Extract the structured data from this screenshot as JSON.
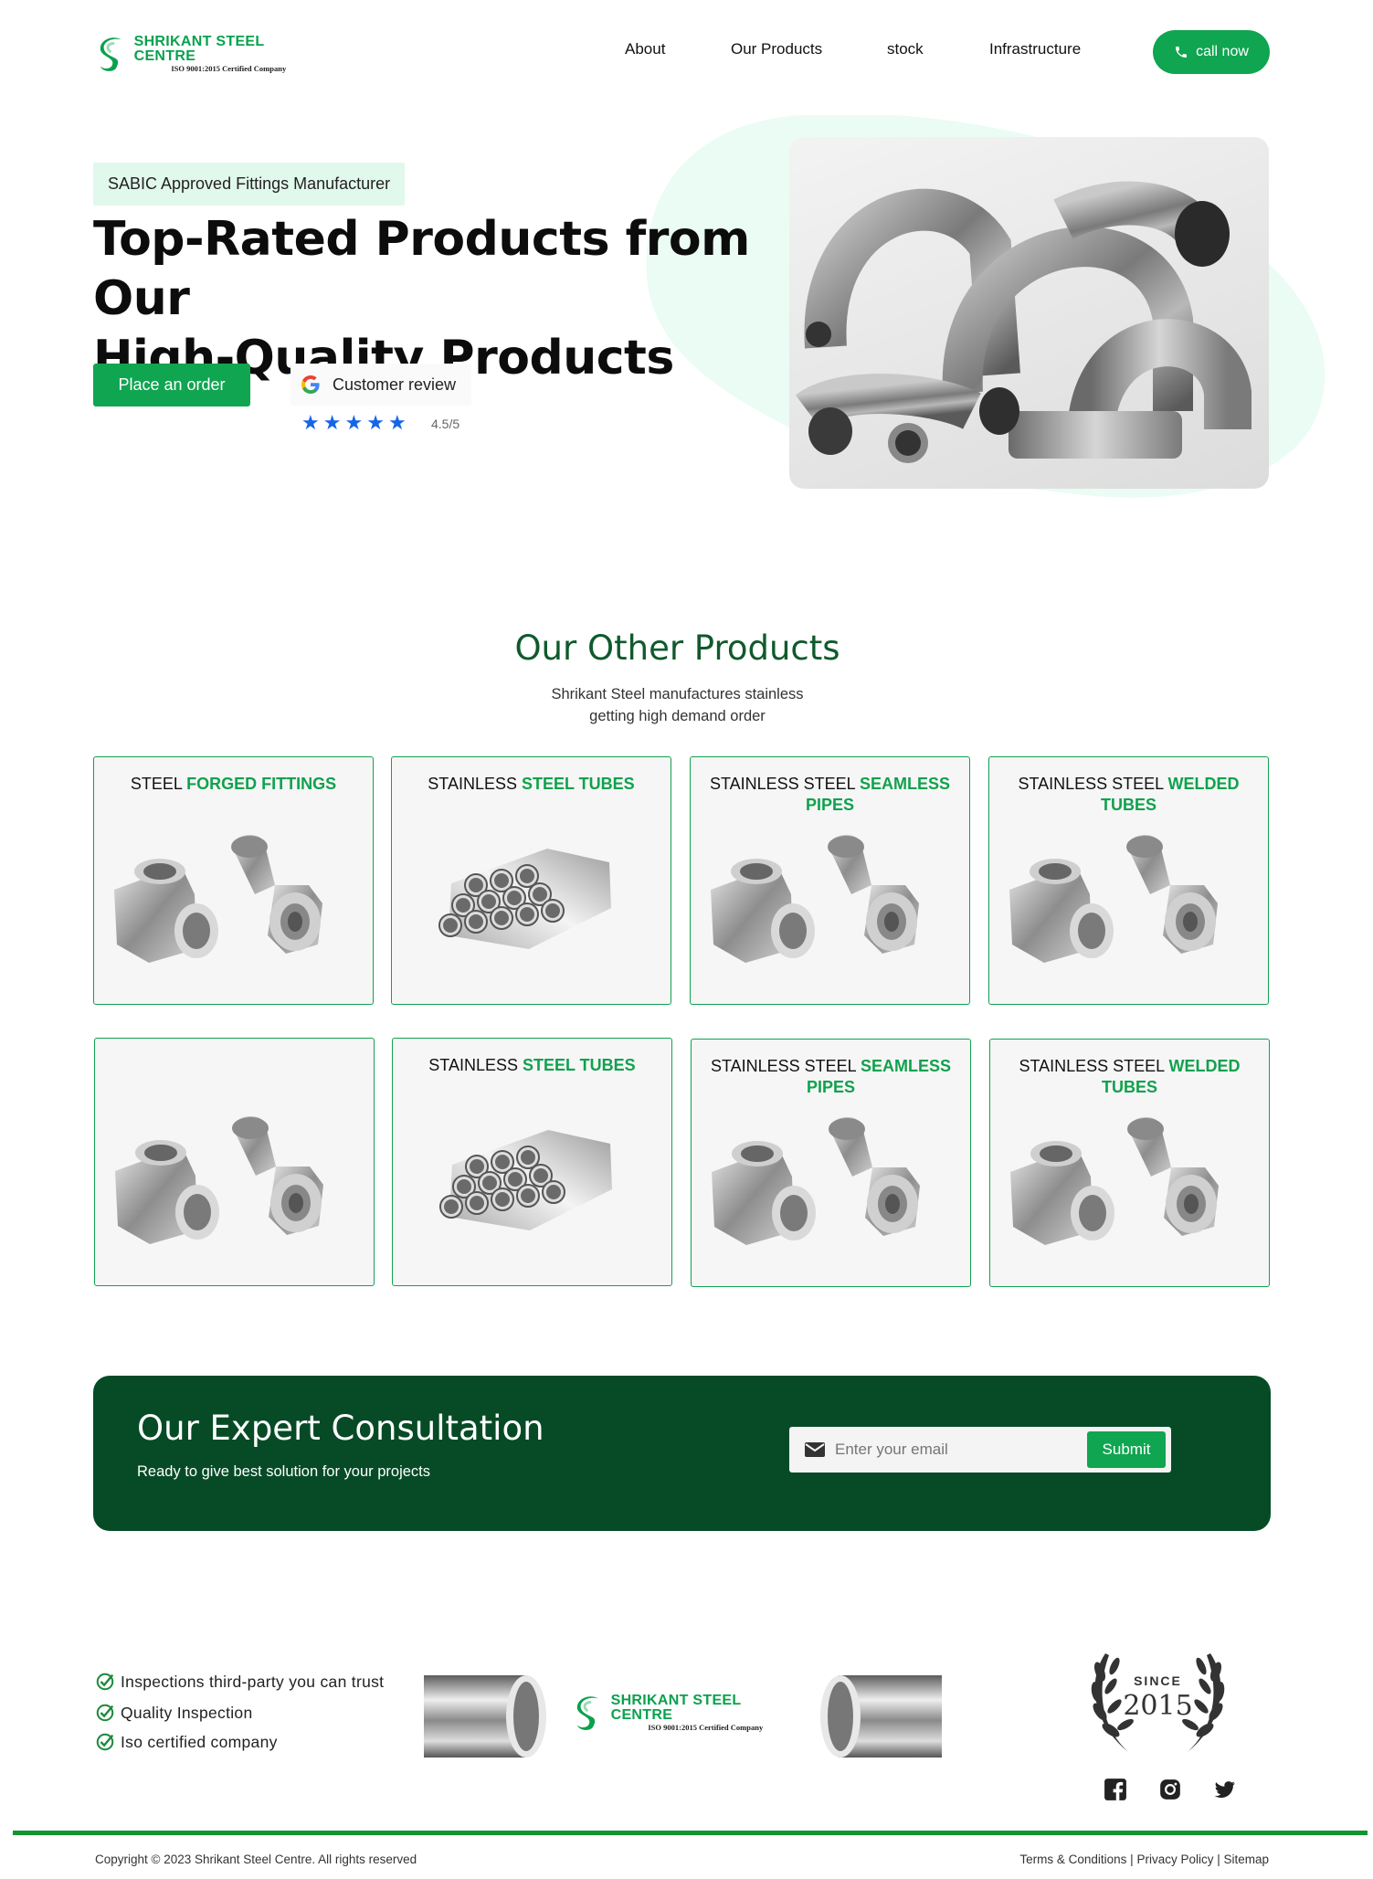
{
  "brand": {
    "name": "SHRIKANT STEEL CENTRE",
    "tagline": "ISO 9001:2015 Certified Company"
  },
  "nav": {
    "items": [
      "About",
      "Our Products",
      "stock",
      "Infrastructure"
    ],
    "call_label": "call now"
  },
  "hero": {
    "badge": "SABIC Approved Fittings Manufacturer",
    "title_line1": "Top-Rated Products from Our",
    "title_line2": "High-Quality Products",
    "order_label": "Place an order",
    "review_label": "Customer review",
    "rating_value": 4.5,
    "rating_text": "4.5/5",
    "stars": 5
  },
  "products": {
    "title": "Our Other Products",
    "subtitle_line1": "Shrikant Steel manufactures stainless",
    "subtitle_line2": "getting high demand order",
    "cards": [
      {
        "plain": "STEEL ",
        "bold": "FORGED FITTINGS",
        "image": "fittings"
      },
      {
        "plain": "STAINLESS ",
        "bold": "STEEL TUBES",
        "image": "tubes"
      },
      {
        "plain": "STAINLESS STEEL ",
        "bold": "SEAMLESS PIPES",
        "image": "fittings"
      },
      {
        "plain": "STAINLESS STEEL ",
        "bold": "WELDED TUBES",
        "image": "fittings"
      },
      {
        "plain": "",
        "bold": "",
        "image": "fittings"
      },
      {
        "plain": "STAINLESS ",
        "bold": "STEEL TUBES",
        "image": "tubes"
      },
      {
        "plain": "STAINLESS STEEL ",
        "bold": "SEAMLESS PIPES",
        "image": "fittings"
      },
      {
        "plain": "STAINLESS STEEL ",
        "bold": "WELDED TUBES",
        "image": "fittings"
      }
    ]
  },
  "consultation": {
    "title": "Our Expert Consultation",
    "subtitle": "Ready to give best solution for your projects",
    "email_placeholder": "Enter your email",
    "submit_label": "Submit"
  },
  "footer": {
    "features": [
      "Inspections third-party you can trust",
      "Quality Inspection",
      "Iso certified company"
    ],
    "since_label": "SINCE",
    "since_year": "2015",
    "social_icons": [
      "facebook-icon",
      "instagram-icon",
      "twitter-icon"
    ],
    "copyright": "Copyright © 2023 Shrikant Steel Centre. All rights reserved",
    "links": "Terms & Conditions | Privacy Policy | Sitemap"
  },
  "colors": {
    "accent": "#10a551",
    "dark_green": "#064b26",
    "title_green": "#0f5a2c",
    "badge_bg": "#e1f8ec",
    "blob": "#eafcf3",
    "star": "#1565e8"
  }
}
